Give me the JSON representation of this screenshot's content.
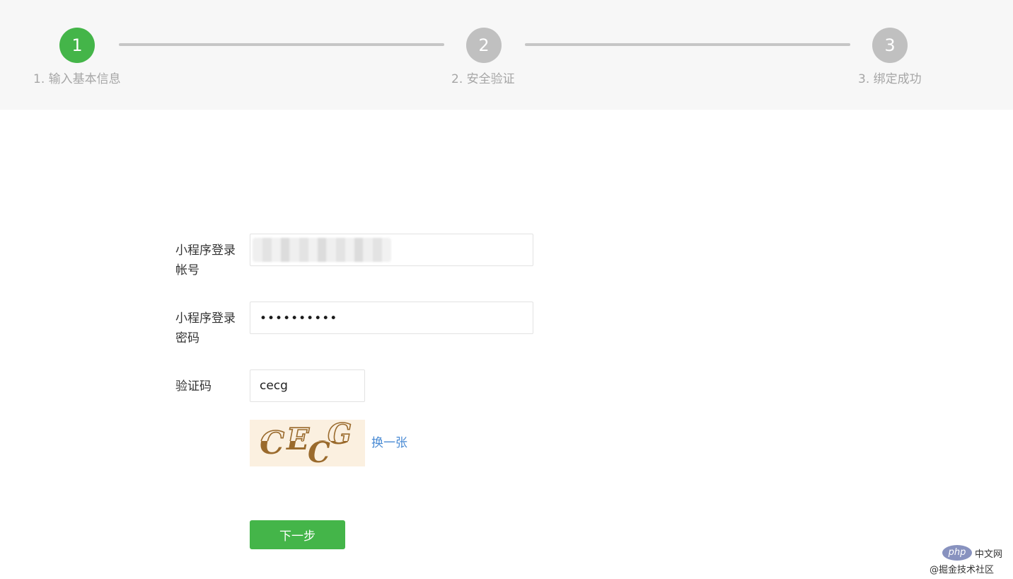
{
  "steps": [
    {
      "number": "1",
      "label": "1. 输入基本信息",
      "state": "active"
    },
    {
      "number": "2",
      "label": "2. 安全验证",
      "state": "pending"
    },
    {
      "number": "3",
      "label": "3. 绑定成功",
      "state": "pending"
    }
  ],
  "form": {
    "account_label_line1": "小程序登录",
    "account_label_line2": "帐号",
    "account_value": "",
    "password_label_line1": "小程序登录",
    "password_label_line2": "密码",
    "password_mask": "••••••••••",
    "captcha_label": "验证码",
    "captcha_value": "cecg",
    "captcha_image_text": "CECG",
    "refresh_link": "换一张",
    "next_button": "下一步"
  },
  "watermark": {
    "logo": "php",
    "logo_suffix": "中文网",
    "site": "@掘金技术社区"
  },
  "colors": {
    "accent": "#44b549",
    "step_inactive": "#c0c0c0",
    "link": "#4a8bd4",
    "steps_background": "#f7f7f7"
  }
}
